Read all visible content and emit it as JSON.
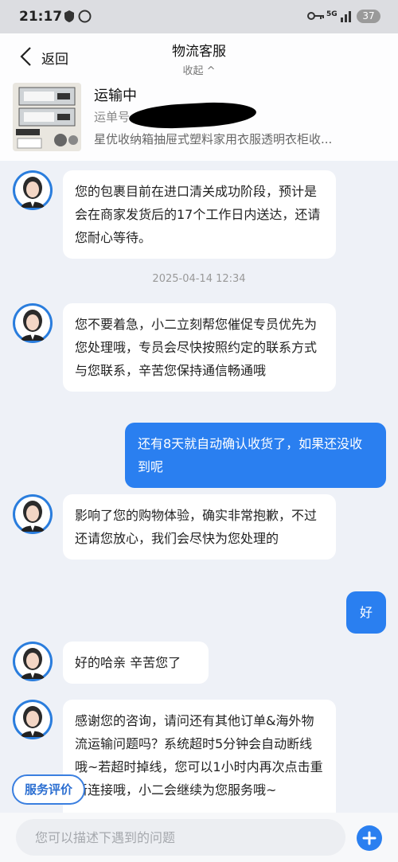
{
  "status_bar": {
    "time": "21:17",
    "battery": "37",
    "network": "5G"
  },
  "header": {
    "back_label": "返回",
    "title": "物流客服",
    "collapse_label": "收起 ^",
    "order": {
      "status": "运输中",
      "waybill_label": "运单号",
      "product_name": "星优收纳箱抽屉式塑料家用衣服透明衣柜收..."
    }
  },
  "messages": [
    {
      "side": "left",
      "text": "您的包裹目前在进口清关成功阶段，预计是会在商家发货后的17个工作日内送达，还请您耐心等待。"
    },
    {
      "side": "left",
      "text": "您不要着急，小二立刻帮您催促专员优先为您处理哦，专员会尽快按照约定的联系方式与您联系，辛苦您保持通信畅通哦"
    },
    {
      "side": "right",
      "text": "还有8天就自动确认收货了，如果还没收到呢"
    },
    {
      "side": "left",
      "text": "影响了您的购物体验，确实非常抱歉，不过还请您放心，我们会尽快为您处理的"
    },
    {
      "side": "right",
      "text": "好"
    },
    {
      "side": "left",
      "text": "好的哈亲 辛苦您了"
    },
    {
      "side": "left",
      "text": "感谢您的咨询，请问还有其他订单&海外物流运输问题吗？系统超时5分钟会自动断线哦~若超时掉线，您可以1小时内再次点击重新连接哦，小二会继续为您服务哦~"
    }
  ],
  "timestamp": "2025-04-14 12:34",
  "rate_button": "服务评价",
  "input": {
    "placeholder": "您可以描述下遇到的问题",
    "value": ""
  },
  "colors": {
    "accent": "#2a7ff0",
    "background": "#eef1f7"
  }
}
